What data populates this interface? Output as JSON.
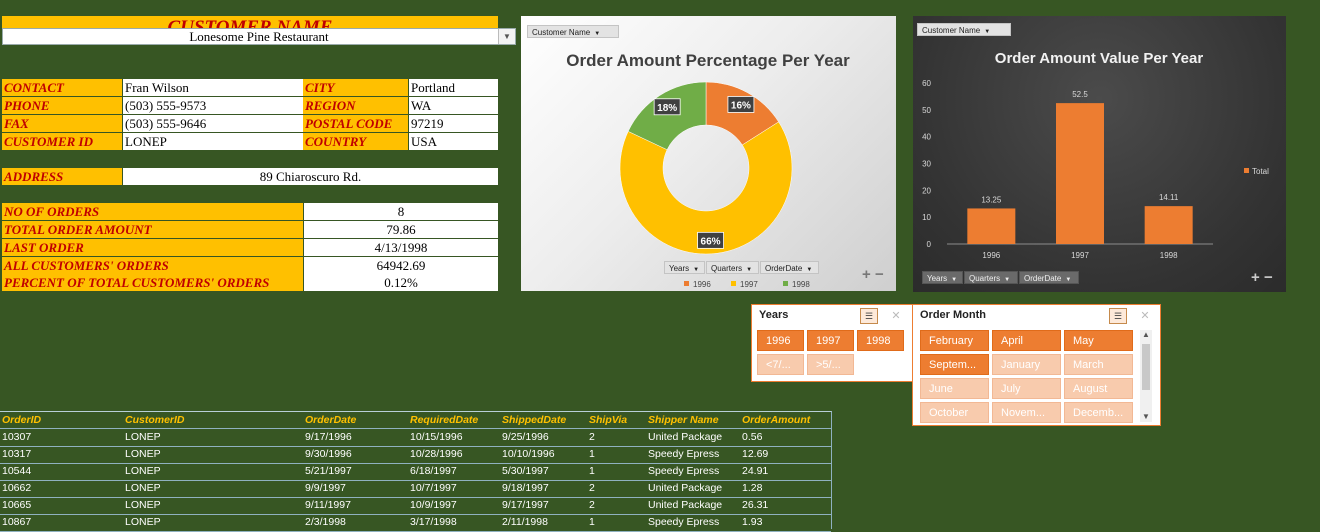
{
  "customer_card": {
    "title": "CUSTOMER NAME",
    "selected_customer": "Lonesome Pine Restaurant",
    "contact_label": "CONTACT",
    "contact": "Fran Wilson",
    "city_label": "CITY",
    "city": "Portland",
    "phone_label": "PHONE",
    "phone": "(503) 555-9573",
    "region_label": "REGION",
    "region": "WA",
    "fax_label": "FAX",
    "fax": "(503) 555-9646",
    "postal_label": "POSTAL CODE",
    "postal": "97219",
    "customer_id_label": "CUSTOMER ID",
    "customer_id": "LONEP",
    "country_label": "COUNTRY",
    "country": "USA",
    "address_label": "ADDRESS",
    "address": "89 Chiaroscuro Rd.",
    "stats": [
      {
        "label": "NO OF ORDERS",
        "value": "8"
      },
      {
        "label": "TOTAL ORDER AMOUNT",
        "value": "79.86"
      },
      {
        "label": "LAST ORDER",
        "value": "4/13/1998"
      },
      {
        "label": "ALL CUSTOMERS' ORDERS",
        "value": "64942.69"
      },
      {
        "label": "PERCENT OF TOTAL CUSTOMERS' ORDERS",
        "value": "0.12%"
      }
    ]
  },
  "pie_chart": {
    "filter_button": "Customer Name",
    "field_buttons": [
      "Years",
      "Quarters",
      "OrderDate"
    ],
    "plus": "+",
    "minus": "−"
  },
  "bar_chart": {
    "filter_button": "Customer Name",
    "field_buttons": [
      "Years",
      "Quarters",
      "OrderDate"
    ],
    "plus": "+",
    "minus": "−"
  },
  "chart_data": [
    {
      "type": "pie",
      "title": "Order Amount Percentage Per Year",
      "categories": [
        "1996",
        "1997",
        "1998"
      ],
      "values": [
        16,
        66,
        18
      ],
      "data_labels": [
        "16%",
        "66%",
        "18%"
      ],
      "colors": [
        "#ED7D31",
        "#FFC000",
        "#70AD47"
      ],
      "legend_placement": "bottom"
    },
    {
      "type": "bar",
      "title": "Order Amount Value Per Year",
      "categories": [
        "1996",
        "1997",
        "1998"
      ],
      "series": [
        {
          "name": "Total",
          "values": [
            13.25,
            52.5,
            14.11
          ]
        }
      ],
      "data_labels": [
        "13.25",
        "52.5",
        "14.11"
      ],
      "ylim": [
        0,
        60
      ],
      "y_ticks": [
        "0",
        "10",
        "20",
        "30",
        "40",
        "50",
        "60"
      ],
      "color": "#ED7D31",
      "legend_placement": "right"
    }
  ],
  "slicer_years": {
    "title": "Years",
    "items": [
      {
        "label": "1996",
        "state": "on"
      },
      {
        "label": "1997",
        "state": "on"
      },
      {
        "label": "1998",
        "state": "on"
      },
      {
        "label": "<7/...",
        "state": "off"
      },
      {
        "label": ">5/...",
        "state": "off"
      }
    ]
  },
  "slicer_month": {
    "title": "Order Month",
    "items": [
      {
        "label": "February",
        "state": "on"
      },
      {
        "label": "April",
        "state": "on"
      },
      {
        "label": "May",
        "state": "on"
      },
      {
        "label": "Septem...",
        "state": "on"
      },
      {
        "label": "January",
        "state": "off"
      },
      {
        "label": "March",
        "state": "off"
      },
      {
        "label": "June",
        "state": "off"
      },
      {
        "label": "July",
        "state": "off"
      },
      {
        "label": "August",
        "state": "off"
      },
      {
        "label": "October",
        "state": "off"
      },
      {
        "label": "Novem...",
        "state": "off"
      },
      {
        "label": "Decemb...",
        "state": "off"
      }
    ]
  },
  "orders_table": {
    "headers": [
      "OrderID",
      "CustomerID",
      "OrderDate",
      "RequiredDate",
      "ShippedDate",
      "ShipVia",
      "Shipper Name",
      "OrderAmount"
    ],
    "rows": [
      [
        "10307",
        "LONEP",
        "9/17/1996",
        "10/15/1996",
        "9/25/1996",
        "2",
        "United Package",
        "0.56"
      ],
      [
        "10317",
        "LONEP",
        "9/30/1996",
        "10/28/1996",
        "10/10/1996",
        "1",
        "Speedy Epress",
        "12.69"
      ],
      [
        "10544",
        "LONEP",
        "5/21/1997",
        "6/18/1997",
        "5/30/1997",
        "1",
        "Speedy Epress",
        "24.91"
      ],
      [
        "10662",
        "LONEP",
        "9/9/1997",
        "10/7/1997",
        "9/18/1997",
        "2",
        "United Package",
        "1.28"
      ],
      [
        "10665",
        "LONEP",
        "9/11/1997",
        "10/9/1997",
        "9/17/1997",
        "2",
        "United Package",
        "26.31"
      ],
      [
        "10867",
        "LONEP",
        "2/3/1998",
        "3/17/1998",
        "2/11/1998",
        "1",
        "Speedy Epress",
        "1.93"
      ]
    ]
  }
}
